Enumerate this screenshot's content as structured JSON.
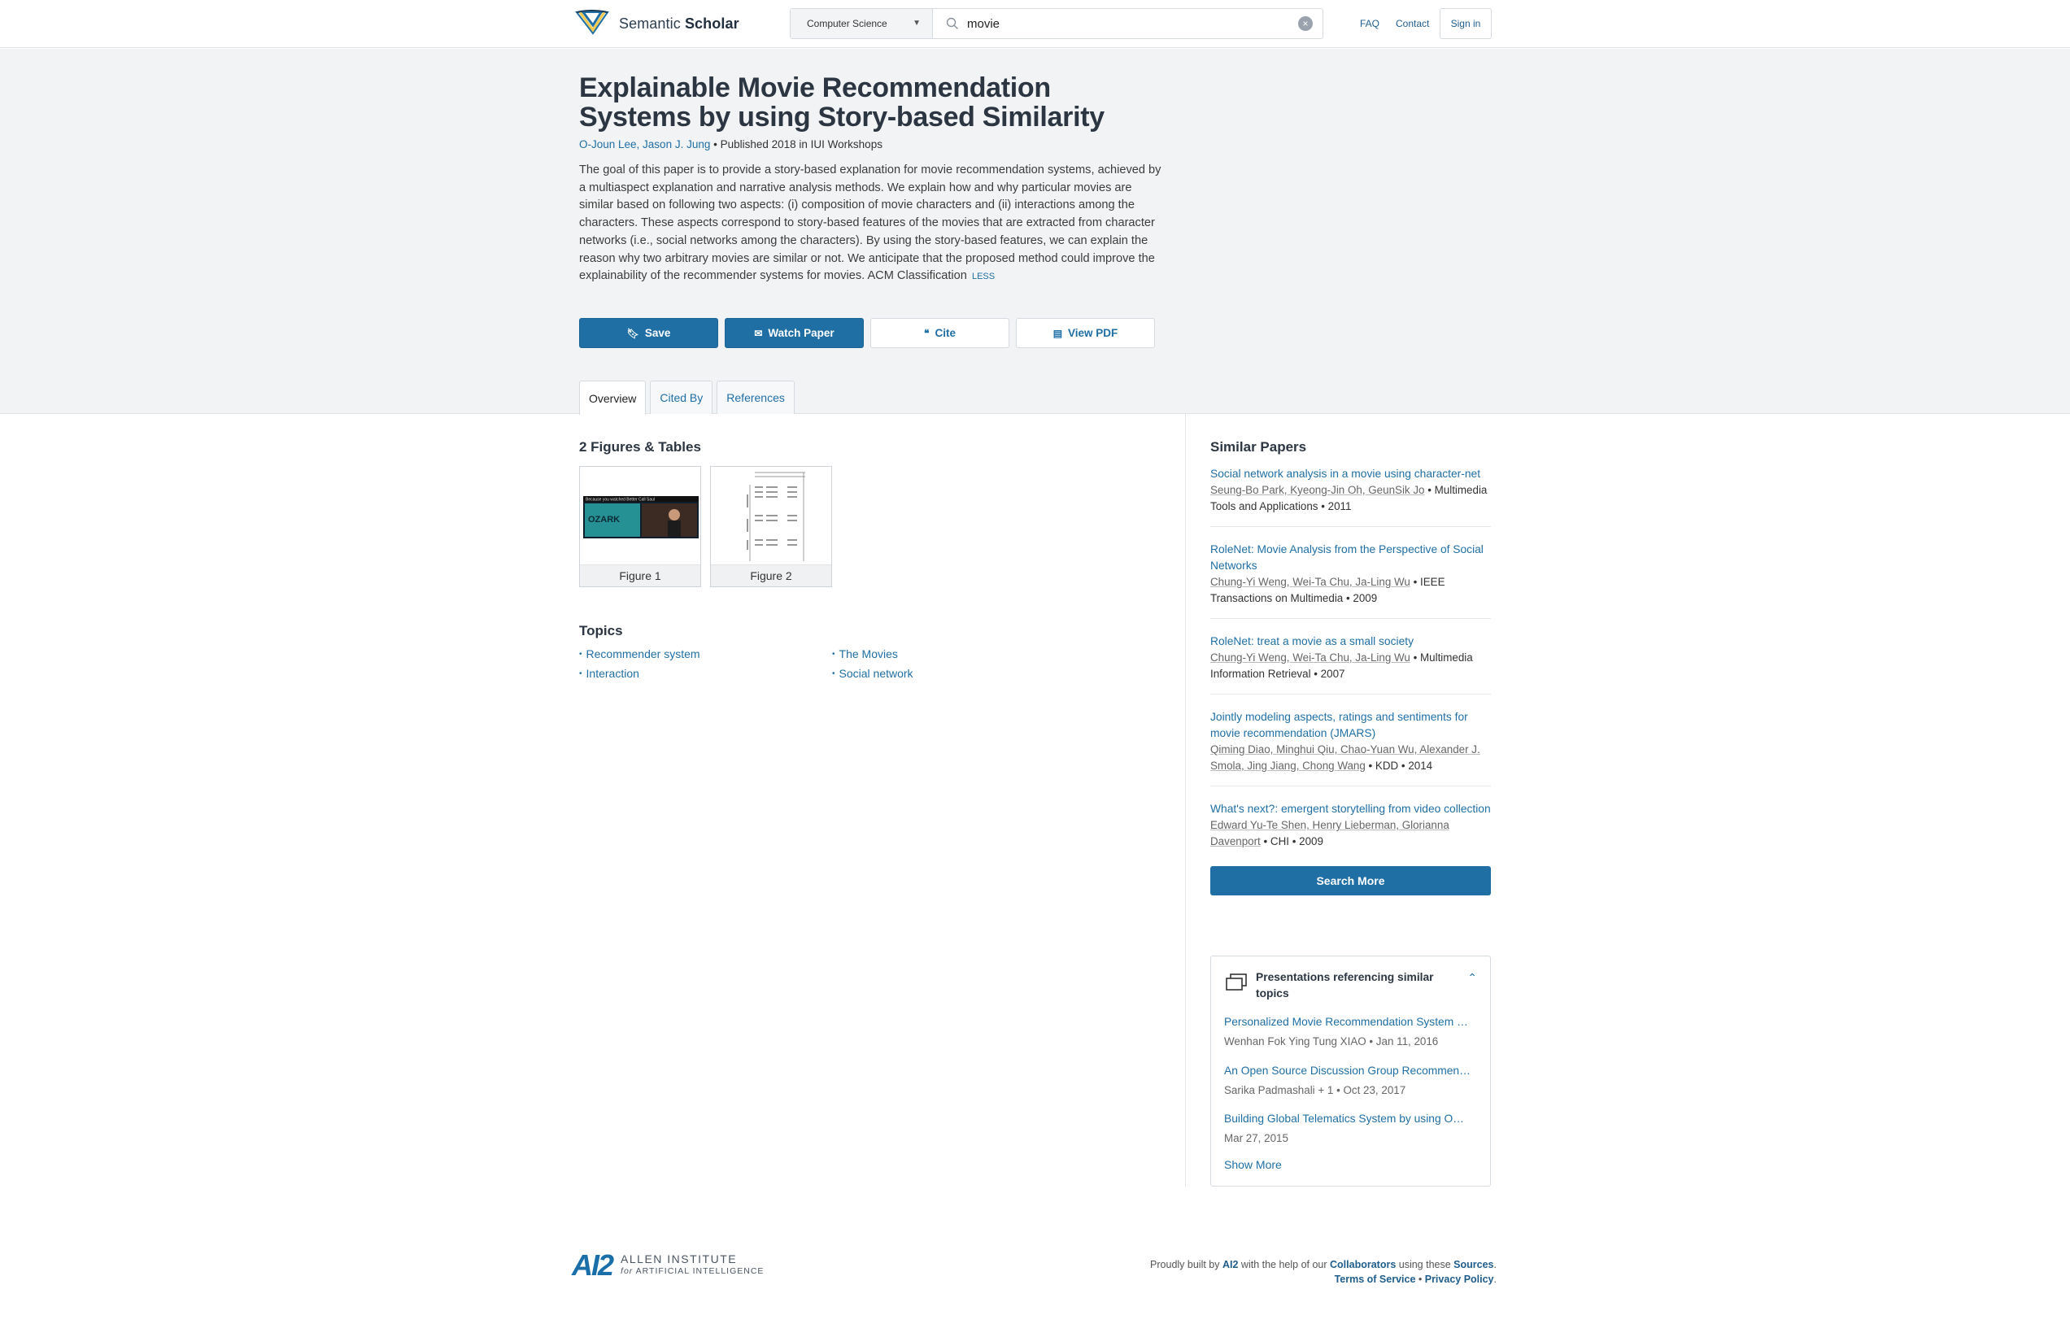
{
  "header": {
    "logo_text_light": "Semantic",
    "logo_text_bold": "Scholar",
    "field_select": "Computer Science",
    "search_value": "movie",
    "links": [
      "FAQ",
      "Contact"
    ],
    "signin": "Sign in"
  },
  "paper": {
    "title": "Explainable Movie Recommendation Systems by using Story-based Similarity",
    "authors": "O-Joun Lee, Jason J. Jung",
    "published": " • Published 2018 in IUI Workshops",
    "abstract": "The goal of this paper is to provide a story-based explanation for movie recommendation systems, achieved by a multiaspect explanation and narrative analysis methods. We explain how and why particular movies are similar based on following two aspects: (i) composition of movie characters and (ii) interactions among the characters. These aspects correspond to story-based features of the movies that are extracted from character networks (i.e., social networks among the characters). By using the story-based features, we can explain the reason why two arbitrary movies are similar or not. We anticipate that the proposed method could improve the explainability of the recommender systems for movies. ACM Classification",
    "less": "LESS",
    "buttons": {
      "save": "Save",
      "watch": "Watch Paper",
      "cite": "Cite",
      "pdf": "View PDF"
    },
    "tabs": [
      "Overview",
      "Cited By",
      "References"
    ]
  },
  "figures": {
    "heading": "2 Figures & Tables",
    "items": [
      "Figure 1",
      "Figure 2"
    ],
    "fig1_banner": "Because you watched Better Call Saul",
    "fig1_title": "OZARK"
  },
  "topics": {
    "heading": "Topics",
    "items": [
      "Recommender system",
      "The Movies",
      "Interaction",
      "Social network"
    ]
  },
  "similar": {
    "heading": "Similar Papers",
    "papers": [
      {
        "title": "Social network analysis in a movie using character-net",
        "authors": "Seung-Bo Park, Kyeong-Jin Oh, GeunSik Jo",
        "venue": " • Multimedia Tools and Applications • 2011"
      },
      {
        "title": "RoleNet: Movie Analysis from the Perspective of Social Networks",
        "authors": "Chung-Yi Weng, Wei-Ta Chu, Ja-Ling Wu",
        "venue": " • IEEE Transactions on Multimedia • 2009"
      },
      {
        "title": "RoleNet: treat a movie as a small society",
        "authors": "Chung-Yi Weng, Wei-Ta Chu, Ja-Ling Wu",
        "venue": " • Multimedia Information Retrieval • 2007"
      },
      {
        "title": "Jointly modeling aspects, ratings and sentiments for movie recommendation (JMARS)",
        "authors": "Qiming Diao, Minghui Qiu, Chao-Yuan Wu, Alexander J. Smola, Jing Jiang, Chong Wang",
        "venue": " • KDD • 2014"
      },
      {
        "title": "What's next?: emergent storytelling from video collection",
        "authors": "Edward Yu-Te Shen, Henry Lieberman, Glorianna Davenport",
        "venue": " • CHI • 2009"
      }
    ],
    "search_more": "Search More"
  },
  "presentations": {
    "heading": "Presentations referencing similar topics",
    "items": [
      {
        "title": "Personalized Movie Recommendation System …",
        "meta": "Wenhan Fok Ying Tung XIAO • Jan 11, 2016"
      },
      {
        "title": "An Open Source Discussion Group Recommen…",
        "meta": "Sarika Padmashali + 1 • Oct 23, 2017"
      },
      {
        "title": "Building Global Telematics System by using O…",
        "meta": "Mar 27, 2015"
      }
    ],
    "show_more": "Show More"
  },
  "footer": {
    "logo_mark": "AI2",
    "logo_line1": "ALLEN INSTITUTE",
    "logo_line2_for": "for",
    "logo_line2": "ARTIFICIAL INTELLIGENCE",
    "line1_a": "Proudly built by ",
    "line1_ai2": "AI2",
    "line1_b": " with the help of our ",
    "line1_collab": "Collaborators",
    "line1_c": " using these ",
    "line1_sources": "Sources",
    "line1_d": ".",
    "terms": "Terms of Service",
    "sep": " • ",
    "privacy": "Privacy Policy",
    "privacy_dot": "."
  }
}
